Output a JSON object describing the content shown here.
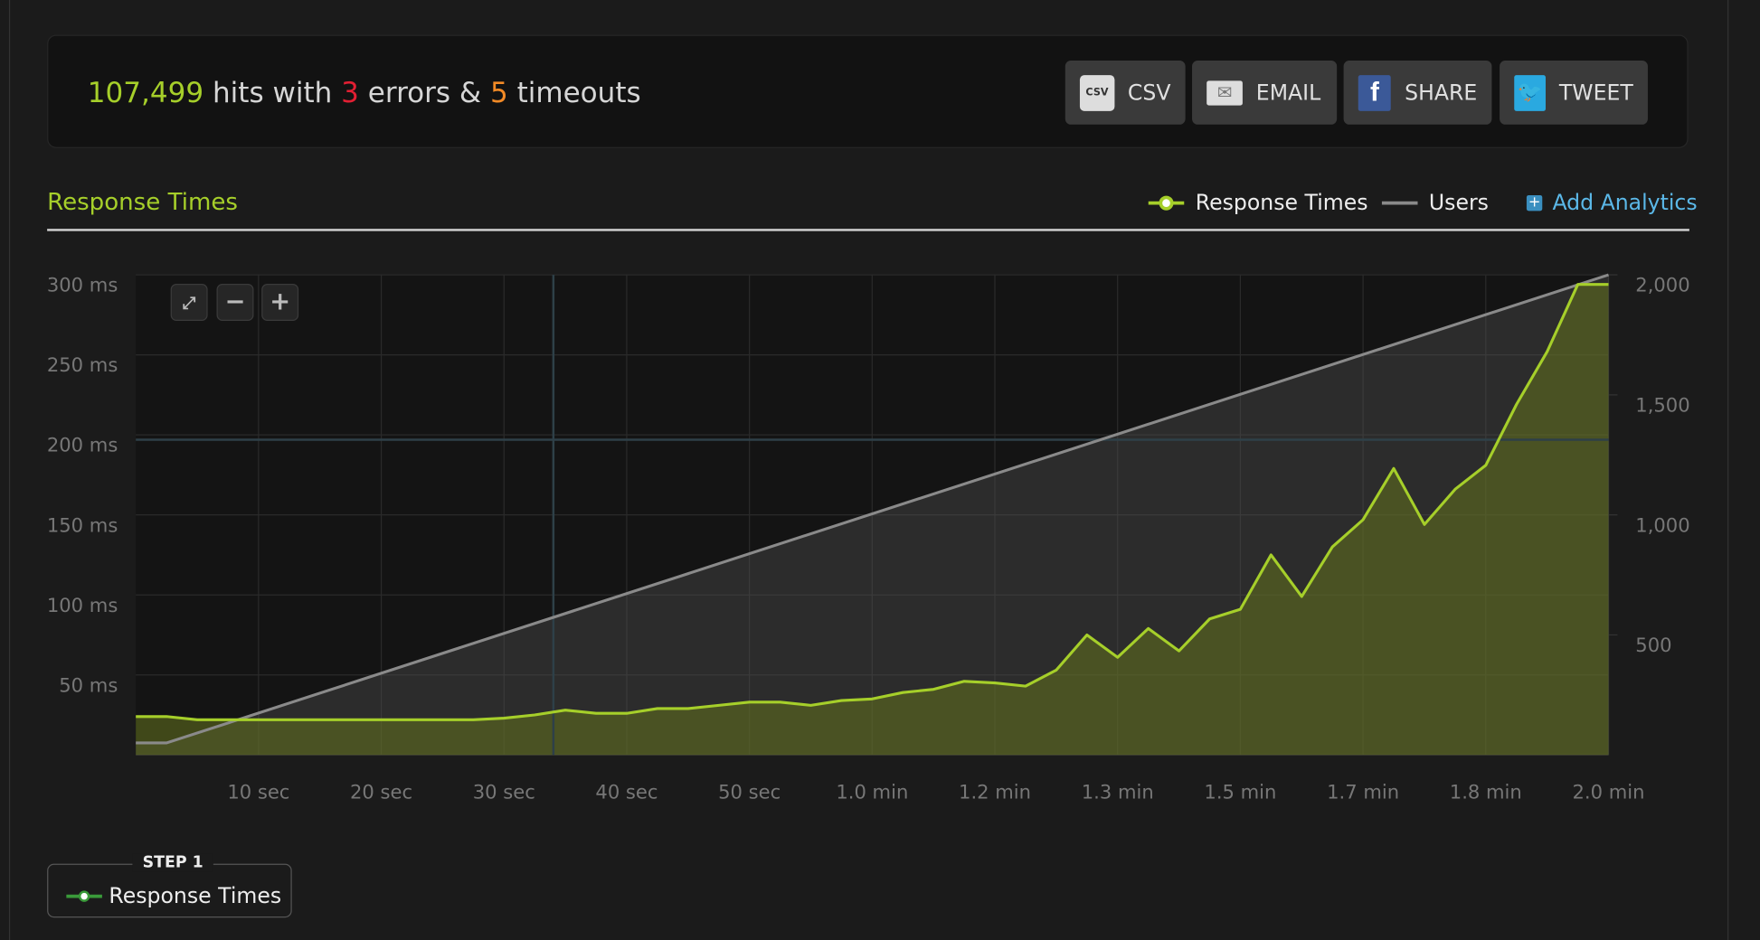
{
  "summary": {
    "hits": "107,499",
    "hits_text": " hits with ",
    "errors": "3",
    "errors_text": " errors & ",
    "timeouts": "5",
    "timeouts_text": " timeouts"
  },
  "buttons": [
    {
      "label": "CSV",
      "icon": "csv-file-icon"
    },
    {
      "label": "EMAIL",
      "icon": "envelope-icon"
    },
    {
      "label": "SHARE",
      "icon": "facebook-icon"
    },
    {
      "label": "TWEET",
      "icon": "twitter-icon"
    }
  ],
  "section": {
    "title": "Response Times",
    "add_analytics": "Add Analytics"
  },
  "colors": {
    "accent": "#a6cf2a",
    "error": "#e21f33",
    "timeout": "#f28a26",
    "link": "#5bb8e8",
    "users_line": "#8a8a8a"
  },
  "step": {
    "label": "STEP 1",
    "item": "Response Times"
  },
  "chart_data": {
    "type": "area",
    "title": "",
    "x_unit": "seconds",
    "xlim": [
      0,
      120
    ],
    "x_ticks": [
      {
        "v": 10,
        "label": "10 sec"
      },
      {
        "v": 20,
        "label": "20 sec"
      },
      {
        "v": 30,
        "label": "30 sec"
      },
      {
        "v": 40,
        "label": "40 sec"
      },
      {
        "v": 50,
        "label": "50 sec"
      },
      {
        "v": 60,
        "label": "1.0 min"
      },
      {
        "v": 70,
        "label": "1.2 min"
      },
      {
        "v": 80,
        "label": "1.3 min"
      },
      {
        "v": 90,
        "label": "1.5 min"
      },
      {
        "v": 100,
        "label": "1.7 min"
      },
      {
        "v": 110,
        "label": "1.8 min"
      },
      {
        "v": 120,
        "label": "2.0 min"
      }
    ],
    "y_left": {
      "lim": [
        0,
        300
      ],
      "ticks": [
        {
          "v": 50,
          "label": "50 ms"
        },
        {
          "v": 100,
          "label": "100 ms"
        },
        {
          "v": 150,
          "label": "150 ms"
        },
        {
          "v": 200,
          "label": "200 ms"
        },
        {
          "v": 250,
          "label": "250 ms"
        },
        {
          "v": 300,
          "label": "300 ms"
        }
      ]
    },
    "y_right": {
      "lim": [
        0,
        2000
      ],
      "ticks": [
        {
          "v": 500,
          "label": "500"
        },
        {
          "v": 1000,
          "label": "1,000"
        },
        {
          "v": 1500,
          "label": "1,500"
        },
        {
          "v": 2000,
          "label": "2,000"
        }
      ]
    },
    "grid": true,
    "legend_position": "top-right",
    "series": [
      {
        "name": "Response Times",
        "axis": "left",
        "color": "#a6cf2a",
        "x": [
          0,
          2.5,
          5,
          7.5,
          10,
          12.5,
          15,
          17.5,
          20,
          22.5,
          25,
          27.5,
          30,
          32.5,
          35,
          37.5,
          40,
          42.5,
          45,
          47.5,
          50,
          52.5,
          55,
          57.5,
          60,
          62.5,
          65,
          67.5,
          70,
          72.5,
          75,
          77.5,
          80,
          82.5,
          85,
          87.5,
          90,
          92.5,
          95,
          97.5,
          100,
          102.5,
          105,
          107.5,
          110,
          112.5,
          115,
          117.5,
          120
        ],
        "y": [
          24,
          24,
          22,
          22,
          22,
          22,
          22,
          22,
          22,
          22,
          22,
          22,
          23,
          25,
          28,
          26,
          26,
          29,
          29,
          31,
          33,
          33,
          31,
          34,
          35,
          39,
          41,
          46,
          45,
          43,
          53,
          75,
          61,
          79,
          65,
          85,
          91,
          125,
          99,
          130,
          147,
          179,
          144,
          166,
          181,
          219,
          252,
          294,
          294
        ]
      },
      {
        "name": "Users",
        "axis": "right",
        "color": "#8a8a8a",
        "x": [
          0,
          2.5,
          120
        ],
        "y": [
          50,
          50,
          2000
        ]
      }
    ]
  }
}
